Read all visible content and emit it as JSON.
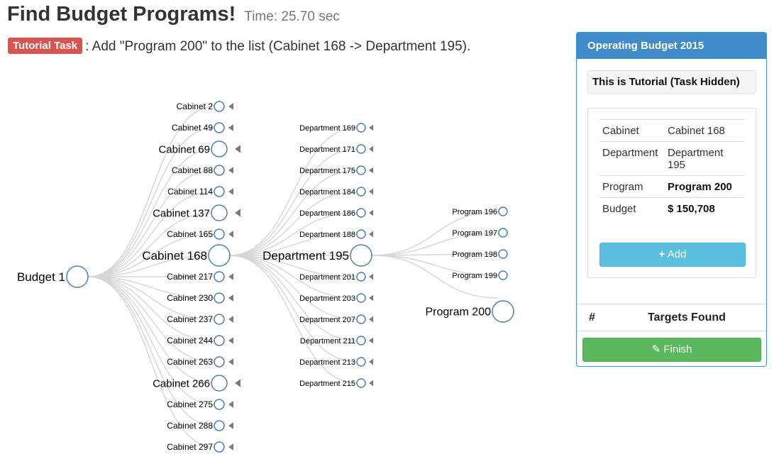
{
  "header": {
    "title": "Find Budget Programs!",
    "time": "Time: 25.70 sec"
  },
  "task": {
    "badge": "Tutorial Task",
    "text": ": Add \"Program 200\" to the list (Cabinet 168 -> Department 195)."
  },
  "tree": {
    "root": "Budget 1",
    "cabinets": [
      "Cabinet 2",
      "Cabinet 49",
      "Cabinet 69",
      "Cabinet 88",
      "Cabinet 114",
      "Cabinet 137",
      "Cabinet 165",
      "Cabinet 168",
      "Cabinet 217",
      "Cabinet 230",
      "Cabinet 237",
      "Cabinet 244",
      "Cabinet 263",
      "Cabinet 266",
      "Cabinet 275",
      "Cabinet 288",
      "Cabinet 297"
    ],
    "departments": [
      "Department 169",
      "Department 171",
      "Department 175",
      "Department 184",
      "Department 186",
      "Department 188",
      "Department 195",
      "Department 201",
      "Department 203",
      "Department 207",
      "Department 211",
      "Department 213",
      "Department 215"
    ],
    "programs": [
      "Program 196",
      "Program 197",
      "Program 198",
      "Program 199",
      "Program 200"
    ],
    "expanded_cabinet": "Cabinet 168",
    "expanded_department": "Department 195",
    "highlighted_program": "Program 200",
    "colors": {
      "link": "#d6d6d3",
      "node_stroke": "#4a80b4",
      "highlight": "#33cc33"
    }
  },
  "panel": {
    "title": "Operating Budget 2015",
    "notice": "This is Tutorial (Task Hidden)",
    "rows": [
      {
        "key": "Cabinet",
        "value": "Cabinet 168",
        "bold": false
      },
      {
        "key": "Department",
        "value": "Department 195",
        "bold": false
      },
      {
        "key": "Program",
        "value": "Program 200",
        "bold": true
      },
      {
        "key": "Budget",
        "value": "$ 150,708",
        "bold": true
      }
    ],
    "add_label": "Add",
    "targets_hash": "#",
    "targets_label": "Targets Found",
    "finish_label": "Finish"
  }
}
